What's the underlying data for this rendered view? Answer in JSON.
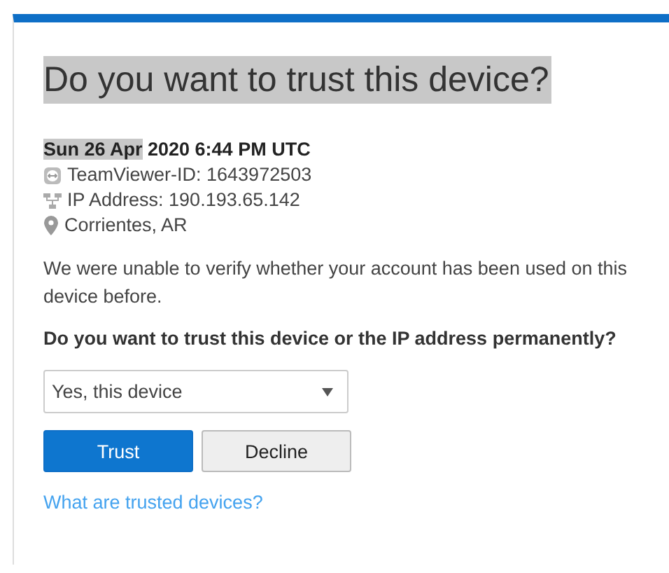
{
  "title": {
    "text": "Do you want to trust this device?",
    "highlighted": true
  },
  "date": {
    "highlighted_part": "Sun 26 Apr",
    "rest": " 2020 6:44 PM UTC"
  },
  "details": [
    {
      "kind": "teamviewer",
      "text": "TeamViewer-ID: 1643972503"
    },
    {
      "kind": "network",
      "text": "IP Address: 190.193.65.142"
    },
    {
      "kind": "location",
      "text": "Corrientes, AR"
    }
  ],
  "message": "We were unable to verify whether your account has been used on this device before.",
  "question": "Do you want to trust this device or the IP address permanently?",
  "select": {
    "value": "Yes, this device"
  },
  "buttons": [
    {
      "kind": "primary",
      "label": "Trust"
    },
    {
      "kind": "secondary",
      "label": "Decline"
    }
  ],
  "link": "What are trusted devices?"
}
